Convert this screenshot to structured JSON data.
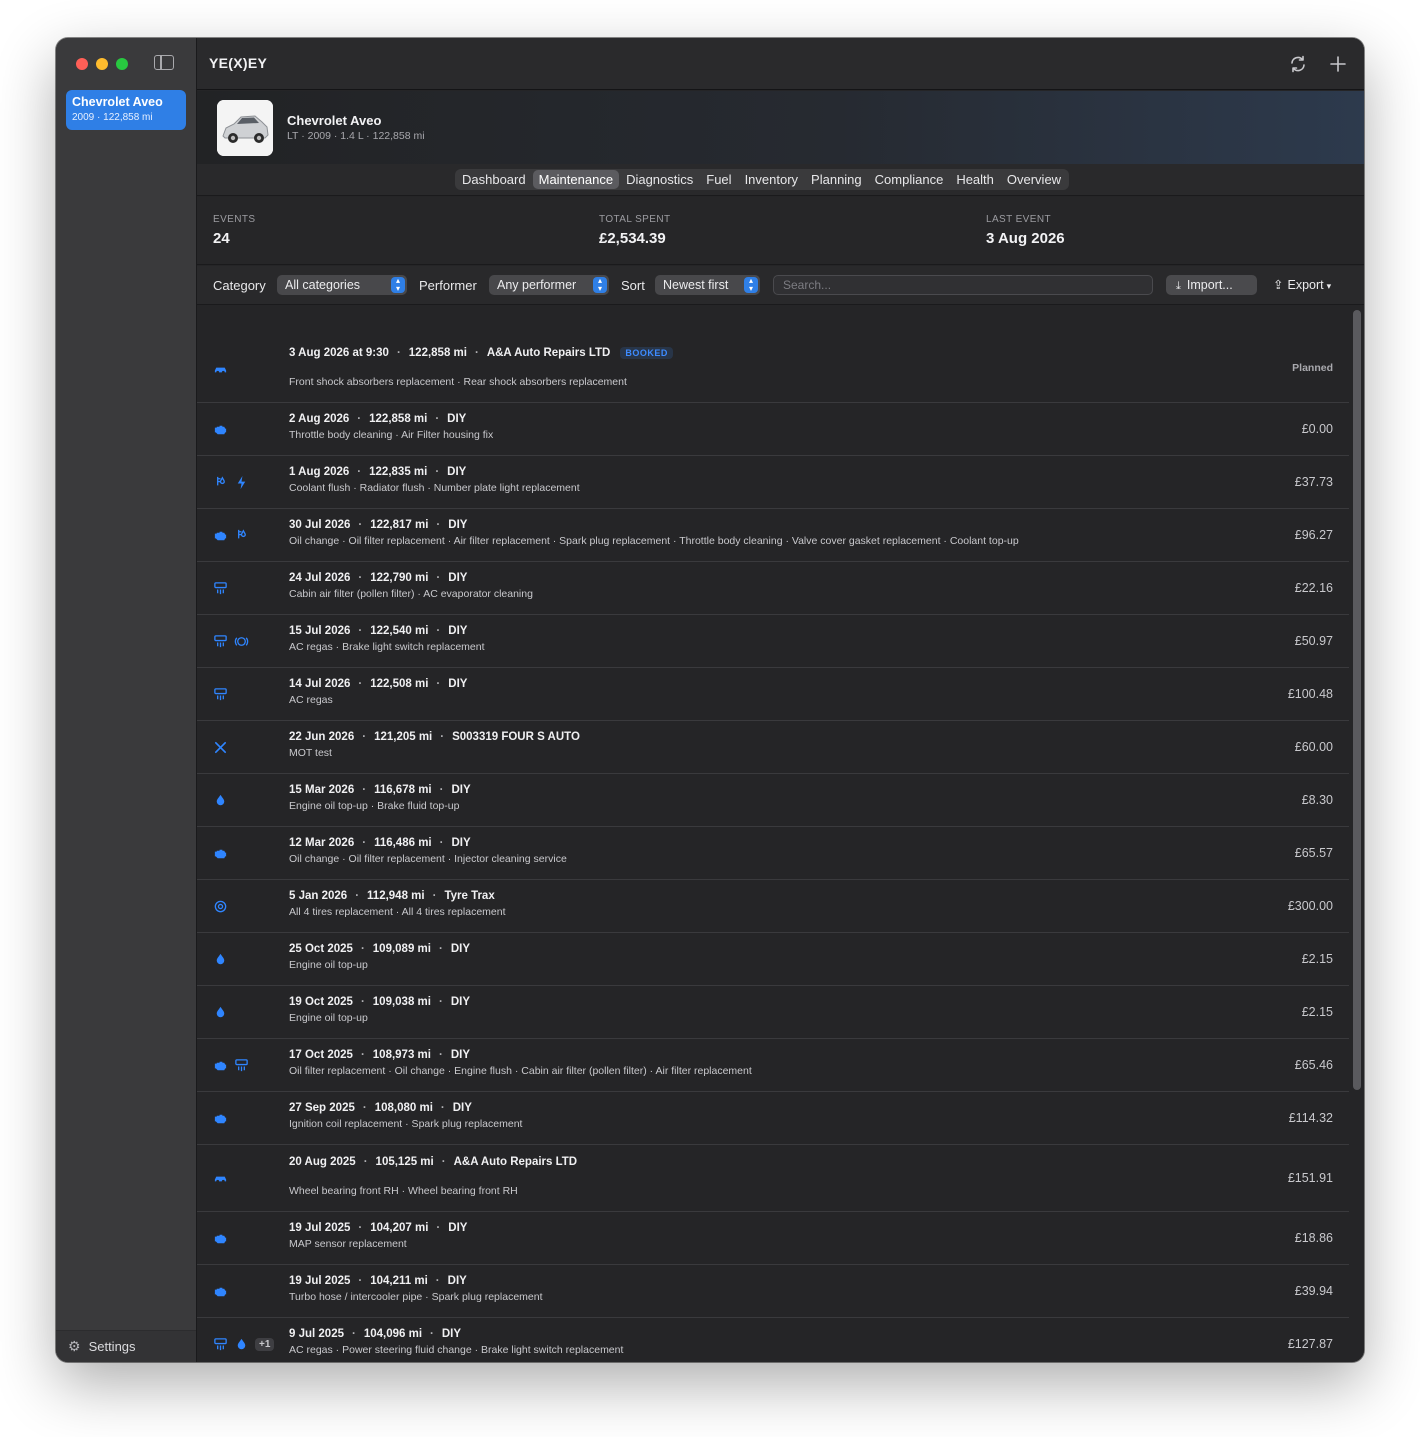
{
  "app": {
    "title": "YE(X)EY"
  },
  "sidebar": {
    "vehicle": {
      "name": "Chevrolet Aveo",
      "sub": "2009 · 122,858 mi"
    },
    "settings_label": "Settings"
  },
  "header": {
    "vehicle_name": "Chevrolet Aveo",
    "vehicle_sub": "LT · 2009 · 1.4 L · 122,858 mi"
  },
  "tabs": [
    {
      "label": "Dashboard",
      "active": false
    },
    {
      "label": "Maintenance",
      "active": true
    },
    {
      "label": "Diagnostics",
      "active": false
    },
    {
      "label": "Fuel",
      "active": false
    },
    {
      "label": "Inventory",
      "active": false
    },
    {
      "label": "Planning",
      "active": false
    },
    {
      "label": "Compliance",
      "active": false
    },
    {
      "label": "Health",
      "active": false
    },
    {
      "label": "Overview",
      "active": false
    }
  ],
  "stats": {
    "events_label": "EVENTS",
    "events_value": "24",
    "spent_label": "TOTAL SPENT",
    "spent_value": "£2,534.39",
    "last_label": "LAST EVENT",
    "last_value": "3 Aug 2026"
  },
  "filters": {
    "category_label": "Category",
    "category_value": "All categories",
    "performer_label": "Performer",
    "performer_value": "Any performer",
    "sort_label": "Sort",
    "sort_value": "Newest first",
    "search_placeholder": "Search...",
    "import_label": "Import...",
    "export_label": "Export"
  },
  "colors": {
    "accent": "#2f7fe6",
    "icon": "#2f85ff",
    "window_bg": "#252527",
    "sidebar_bg": "#3a3a3c"
  },
  "events": [
    {
      "date": "3 Aug 2026 at 9:30",
      "mileage": "122,858 mi",
      "performer": "A&A Auto Repairs LTD",
      "badge": "BOOKED",
      "desc": "Front shock absorbers replacement · Rear shock absorbers replacement",
      "amount": "Planned",
      "icons": [
        "car-lift-icon"
      ]
    },
    {
      "date": "2 Aug 2026",
      "mileage": "122,858 mi",
      "performer": "DIY",
      "desc": "Throttle body cleaning · Air Filter housing fix",
      "amount": "£0.00",
      "icons": [
        "engine-icon"
      ]
    },
    {
      "date": "1 Aug 2026",
      "mileage": "122,835 mi",
      "performer": "DIY",
      "desc": "Coolant flush · Radiator flush · Number plate light replacement",
      "amount": "£37.73",
      "icons": [
        "coolant-icon",
        "bolt-icon"
      ]
    },
    {
      "date": "30 Jul 2026",
      "mileage": "122,817 mi",
      "performer": "DIY",
      "desc": "Oil change · Oil filter replacement · Air filter replacement · Spark plug replacement · Throttle body cleaning · Valve cover gasket replacement · Coolant top-up",
      "amount": "£96.27",
      "icons": [
        "engine-icon",
        "coolant-icon"
      ]
    },
    {
      "date": "24 Jul 2026",
      "mileage": "122,790 mi",
      "performer": "DIY",
      "desc": "Cabin air filter (pollen filter) · AC evaporator cleaning",
      "amount": "£22.16",
      "icons": [
        "air-vent-icon"
      ]
    },
    {
      "date": "15 Jul 2026",
      "mileage": "122,540 mi",
      "performer": "DIY",
      "desc": "AC regas · Brake light switch replacement",
      "amount": "£50.97",
      "icons": [
        "air-vent-icon",
        "brake-icon"
      ]
    },
    {
      "date": "14 Jul 2026",
      "mileage": "122,508 mi",
      "performer": "DIY",
      "desc": "AC regas",
      "amount": "£100.48",
      "icons": [
        "air-vent-icon"
      ]
    },
    {
      "date": "22 Jun 2026",
      "mileage": "121,205 mi",
      "performer": "S003319 FOUR S AUTO",
      "desc": "MOT test",
      "amount": "£60.00",
      "icons": [
        "wrench-icon"
      ]
    },
    {
      "date": "15 Mar 2026",
      "mileage": "116,678 mi",
      "performer": "DIY",
      "desc": "Engine oil top-up · Brake fluid top-up",
      "amount": "£8.30",
      "icons": [
        "drop-icon"
      ]
    },
    {
      "date": "12 Mar 2026",
      "mileage": "116,486 mi",
      "performer": "DIY",
      "desc": "Oil change · Oil filter replacement · Injector cleaning service",
      "amount": "£65.57",
      "icons": [
        "engine-icon"
      ]
    },
    {
      "date": "5 Jan 2026",
      "mileage": "112,948 mi",
      "performer": "Tyre Trax",
      "desc": "All 4 tires replacement · All 4 tires replacement",
      "amount": "£300.00",
      "icons": [
        "tire-icon"
      ]
    },
    {
      "date": "25 Oct 2025",
      "mileage": "109,089 mi",
      "performer": "DIY",
      "desc": "Engine oil top-up",
      "amount": "£2.15",
      "icons": [
        "drop-icon"
      ]
    },
    {
      "date": "19 Oct 2025",
      "mileage": "109,038 mi",
      "performer": "DIY",
      "desc": "Engine oil top-up",
      "amount": "£2.15",
      "icons": [
        "drop-icon"
      ]
    },
    {
      "date": "17 Oct 2025",
      "mileage": "108,973 mi",
      "performer": "DIY",
      "desc": "Oil filter replacement · Oil change · Engine flush · Cabin air filter (pollen filter) · Air filter replacement",
      "amount": "£65.46",
      "icons": [
        "engine-icon",
        "air-vent-icon"
      ]
    },
    {
      "date": "27 Sep 2025",
      "mileage": "108,080 mi",
      "performer": "DIY",
      "desc": "Ignition coil replacement · Spark plug replacement",
      "amount": "£114.32",
      "icons": [
        "engine-icon"
      ]
    },
    {
      "date": "20 Aug 2025",
      "mileage": "105,125 mi",
      "performer": "A&A Auto Repairs LTD",
      "desc": "Wheel bearing front RH · Wheel bearing front RH",
      "amount": "£151.91",
      "icons": [
        "car-lift-icon"
      ]
    },
    {
      "date": "19 Jul 2025",
      "mileage": "104,207 mi",
      "performer": "DIY",
      "desc": "MAP sensor replacement",
      "amount": "£18.86",
      "icons": [
        "engine-icon"
      ]
    },
    {
      "date": "19 Jul 2025",
      "mileage": "104,211 mi",
      "performer": "DIY",
      "desc": "Turbo hose / intercooler pipe · Spark plug replacement",
      "amount": "£39.94",
      "icons": [
        "engine-icon"
      ]
    },
    {
      "date": "9 Jul 2025",
      "mileage": "104,096 mi",
      "performer": "DIY",
      "desc": "AC regas · Power steering fluid change · Brake light switch replacement",
      "amount": "£127.87",
      "icons": [
        "air-vent-icon",
        "drop-icon"
      ],
      "more": "+1"
    }
  ]
}
